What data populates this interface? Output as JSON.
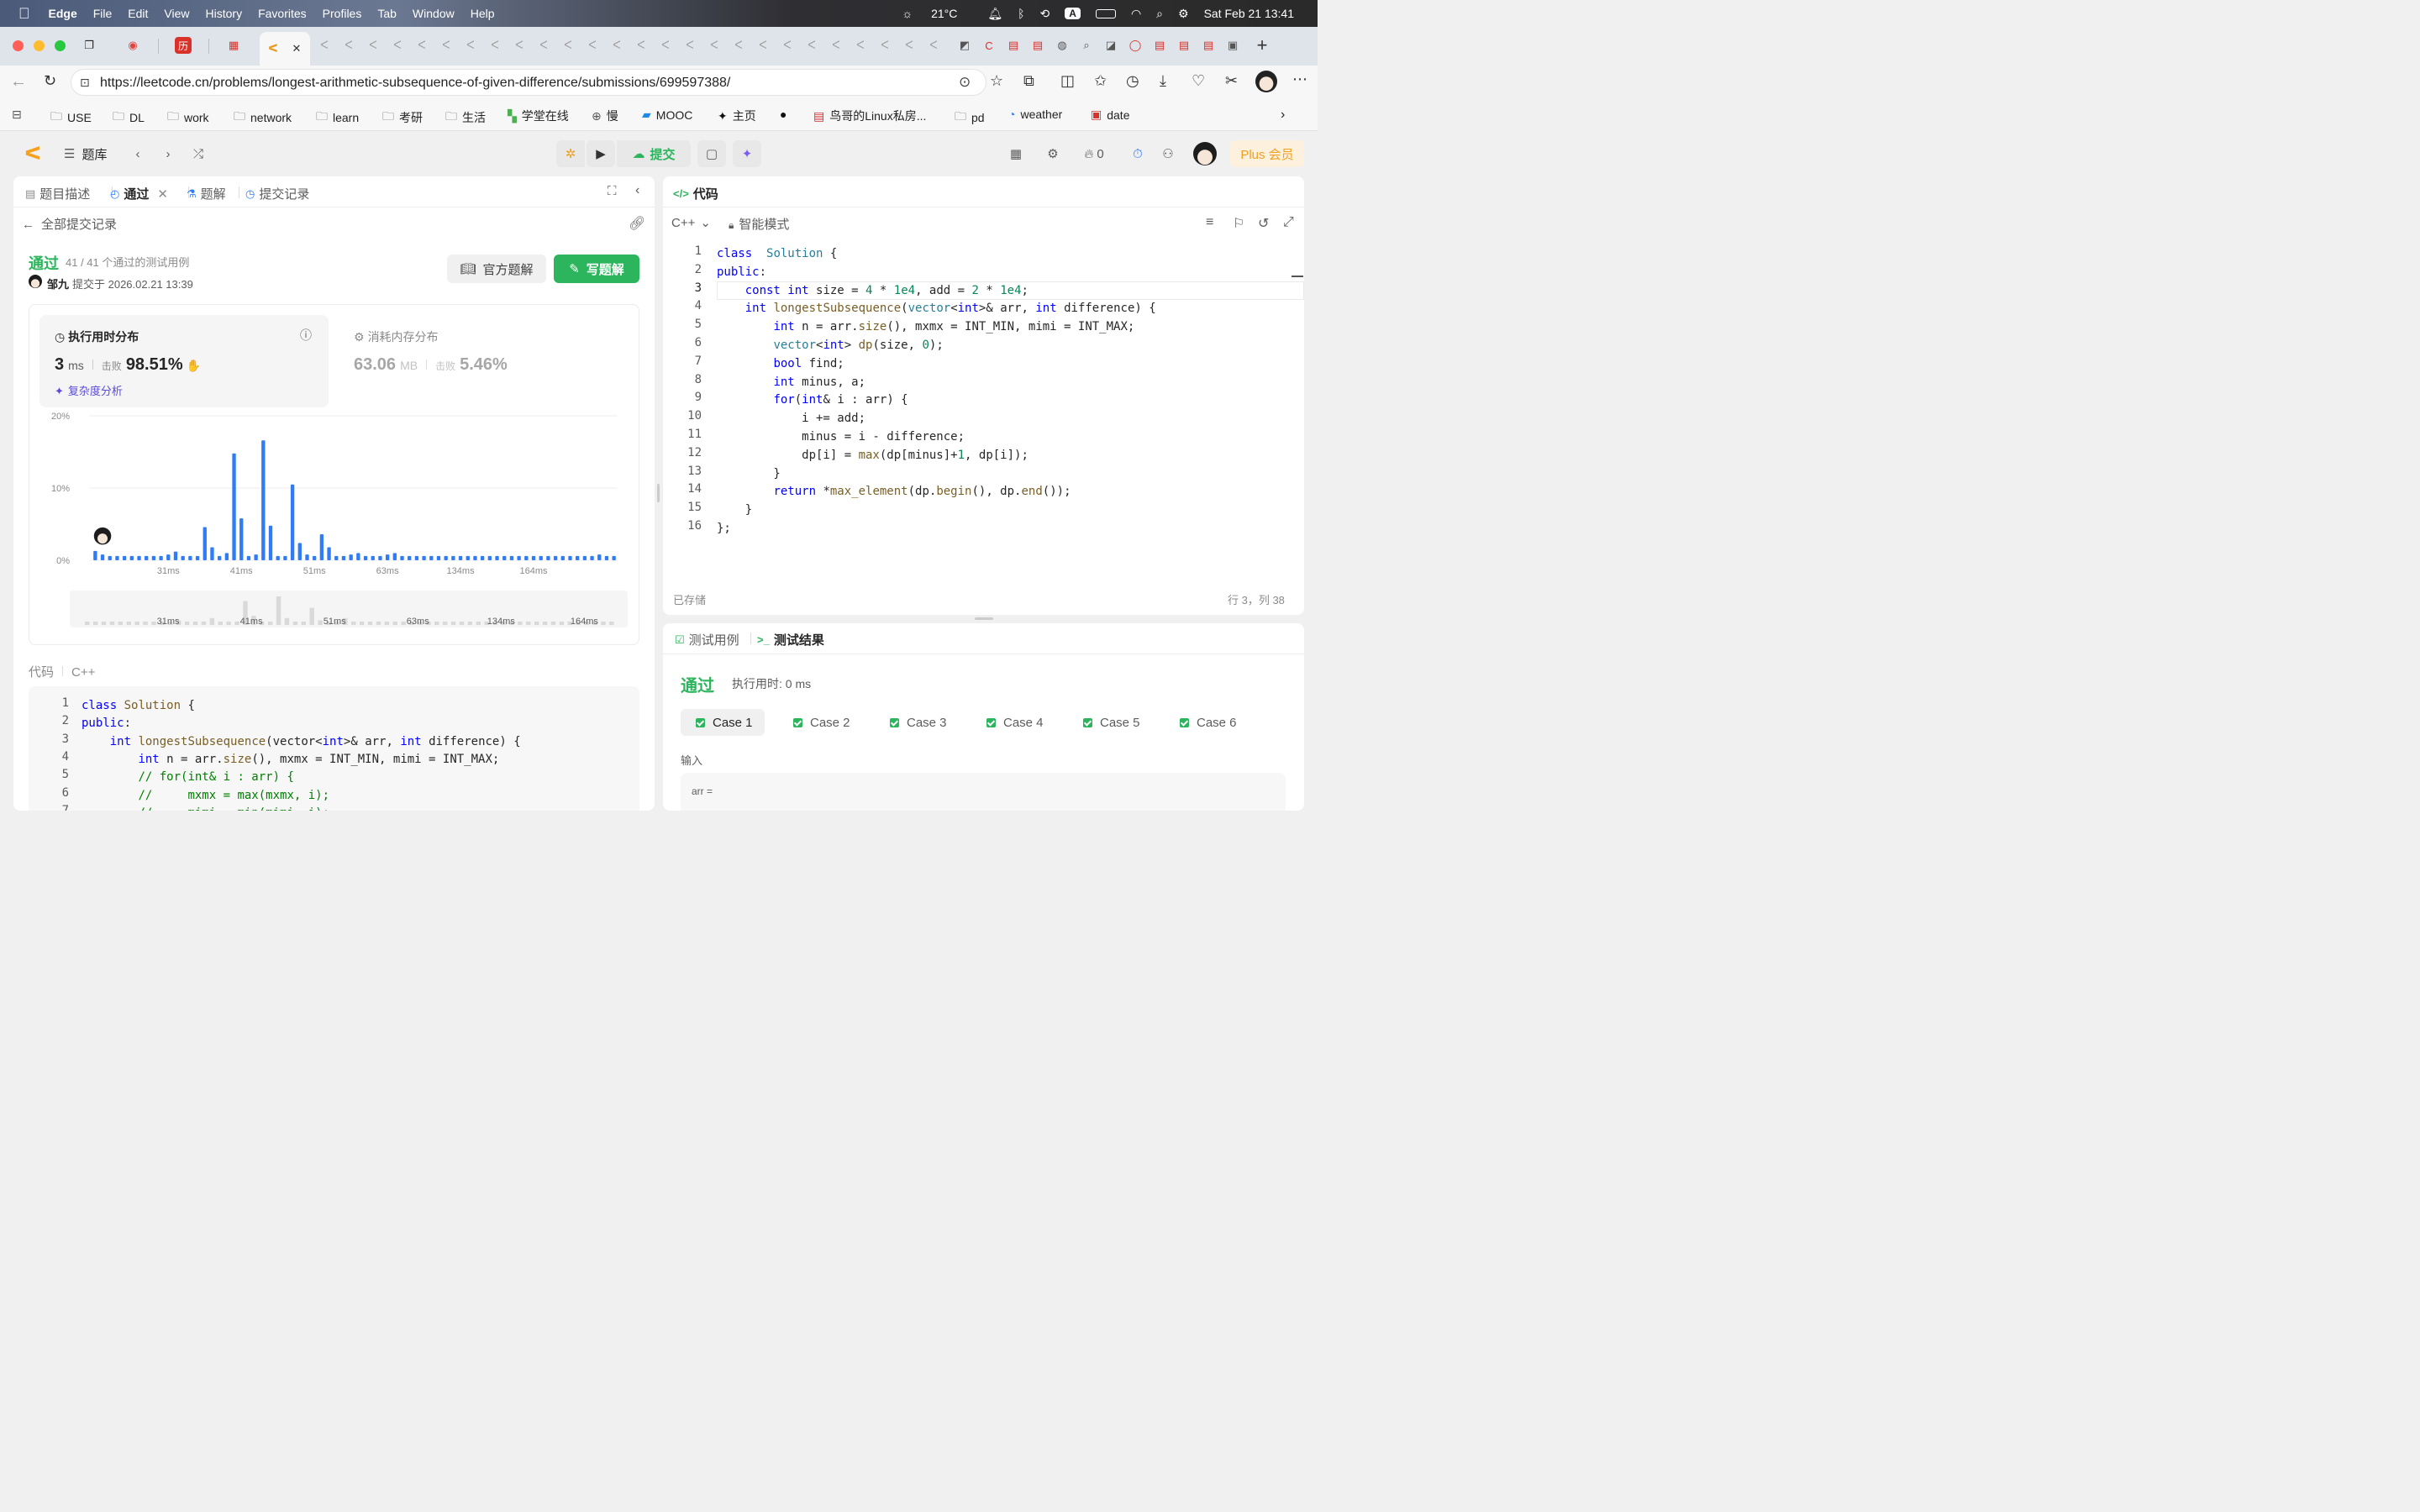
{
  "menubar": {
    "app": "Edge",
    "items": [
      "File",
      "Edit",
      "View",
      "History",
      "Favorites",
      "Profiles",
      "Tab",
      "Window",
      "Help"
    ],
    "weather": "21°C",
    "datetime": "Sat Feb 21  13:41",
    "input_source": "A"
  },
  "browser": {
    "url": "https://leetcode.cn/problems/longest-arithmetic-subsequence-of-given-difference/submissions/699597388/"
  },
  "bookmarks": [
    {
      "label": "",
      "icon": "reading-list"
    },
    {
      "label": "USE",
      "icon": "folder"
    },
    {
      "label": "DL",
      "icon": "folder"
    },
    {
      "label": "work",
      "icon": "folder"
    },
    {
      "label": "network",
      "icon": "folder"
    },
    {
      "label": "learn",
      "icon": "folder"
    },
    {
      "label": "考研",
      "icon": "folder"
    },
    {
      "label": "生活",
      "icon": "folder"
    },
    {
      "label": "学堂在线",
      "icon": "xuetang"
    },
    {
      "label": "慢",
      "icon": "globe"
    },
    {
      "label": "MOOC",
      "icon": "mooc"
    },
    {
      "label": "主页",
      "icon": "home-site"
    },
    {
      "label": "",
      "icon": "github"
    },
    {
      "label": "鸟哥的Linux私房...",
      "icon": "pdf"
    },
    {
      "label": "pd",
      "icon": "folder"
    },
    {
      "label": "weather",
      "icon": "weather"
    },
    {
      "label": "date",
      "icon": "calendar"
    }
  ],
  "lc": {
    "problem_bank": "题库",
    "submit": "提交",
    "fire_count": "0",
    "plus": "Plus 会员"
  },
  "left": {
    "tabs": [
      "题目描述",
      "通过",
      "题解",
      "提交记录"
    ],
    "back_label": "全部提交记录",
    "status": "通过",
    "tests": "41 / 41 个通过的测试用例",
    "user": "邹九",
    "submitted_at": "提交于 2026.02.21 13:39",
    "official_btn": "官方题解",
    "write_btn": "写题解",
    "runtime": {
      "title": "执行用时分布",
      "value": "3",
      "unit": "ms",
      "beat_label": "击败",
      "beat": "98.51%",
      "analysis": "复杂度分析"
    },
    "memory": {
      "title": "消耗内存分布",
      "value": "63.06",
      "unit": "MB",
      "beat_label": "击败",
      "beat": "5.46%"
    },
    "code_label": "代码",
    "code_lang": "C++"
  },
  "chart_data": {
    "type": "bar",
    "yticks": [
      "20%",
      "10%",
      "0%"
    ],
    "ylim": [
      0,
      20
    ],
    "xticks": [
      "31ms",
      "41ms",
      "51ms",
      "63ms",
      "134ms",
      "164ms"
    ],
    "values": [
      1.3,
      0.8,
      0.6,
      0.6,
      0.6,
      0.6,
      0.6,
      0.6,
      0.6,
      0.6,
      0.8,
      1.2,
      0.6,
      0.6,
      0.6,
      4.6,
      1.8,
      0.6,
      1,
      14.8,
      5.8,
      0.6,
      0.8,
      16.6,
      4.8,
      0.6,
      0.6,
      10.5,
      2.4,
      0.8,
      0.6,
      3.6,
      1.8,
      0.6,
      0.6,
      0.8,
      1,
      0.6,
      0.6,
      0.6,
      0.8,
      1,
      0.6,
      0.6,
      0.6,
      0.6,
      0.6,
      0.6,
      0.6,
      0.6,
      0.6,
      0.6,
      0.6,
      0.6,
      0.6,
      0.6,
      0.6,
      0.6,
      0.6,
      0.6,
      0.6,
      0.6,
      0.6,
      0.6,
      0.6,
      0.6,
      0.6,
      0.6,
      0.6,
      0.8,
      0.6,
      0.6
    ],
    "highlight_index": 1,
    "mini_values": [
      0.6,
      0.6,
      0.6,
      0.6,
      0.6,
      0.6,
      0.6,
      0.6,
      0.6,
      0.6,
      0.6,
      0.8,
      0.6,
      0.6,
      0.6,
      1.2,
      0.6,
      0.6,
      0.6,
      4.2,
      1.6,
      0.6,
      0.6,
      5,
      1.2,
      0.6,
      0.6,
      3,
      0.8,
      0.6,
      0.6,
      1.2,
      0.6,
      0.6,
      0.6,
      0.6,
      0.6,
      0.6,
      0.6,
      0.6,
      0.6,
      0.6,
      0.6,
      0.6,
      0.6,
      0.6,
      0.6,
      0.6,
      0.6,
      0.6,
      0.6,
      0.6,
      0.6,
      0.6,
      0.6,
      0.6,
      0.6,
      0.6,
      0.6,
      0.6,
      0.6,
      0.6,
      0.6,
      0.6
    ]
  },
  "editor": {
    "title": "代码",
    "lang": "C++",
    "mode": "智能模式",
    "saved": "已存储",
    "cursor": "行 3，列 38",
    "lines": [
      [
        [
          "kw",
          "class"
        ],
        [
          "",
          "  "
        ],
        [
          "cl",
          "Solution"
        ],
        [
          "",
          " {"
        ]
      ],
      [
        [
          "kw",
          "public"
        ],
        [
          "",
          ":"
        ]
      ],
      [
        [
          "",
          "    "
        ],
        [
          "kw",
          "const"
        ],
        [
          "",
          ""
        ],
        [
          "kw",
          " int"
        ],
        [
          "",
          " size = "
        ],
        [
          "num",
          "4"
        ],
        [
          "",
          " * "
        ],
        [
          "num",
          "1e4"
        ],
        [
          "",
          ", add = "
        ],
        [
          "num",
          "2"
        ],
        [
          "",
          " * "
        ],
        [
          "num",
          "1e4"
        ],
        [
          "",
          ";"
        ]
      ],
      [
        [
          "",
          "    "
        ],
        [
          "kw",
          "int"
        ],
        [
          "",
          ""
        ],
        [
          "fn",
          " longestSubsequence"
        ],
        [
          "",
          "("
        ],
        [
          "cl",
          "vector"
        ],
        [
          "",
          "<"
        ],
        [
          "kw",
          "int"
        ],
        [
          "",
          ">& arr, "
        ],
        [
          "kw",
          "int"
        ],
        [
          "",
          " difference) {"
        ]
      ],
      [
        [
          "",
          "        "
        ],
        [
          "kw",
          "int"
        ],
        [
          "",
          " n = arr."
        ],
        [
          "fn",
          "size"
        ],
        [
          "",
          "(), mxmx = INT_MIN, mimi = INT_MAX;"
        ]
      ],
      [
        [
          "",
          "        "
        ],
        [
          "cl",
          "vector"
        ],
        [
          "",
          "<"
        ],
        [
          "kw",
          "int"
        ],
        [
          "",
          "> "
        ],
        [
          "fn",
          "dp"
        ],
        [
          "",
          "(size, "
        ],
        [
          "num",
          "0"
        ],
        [
          "",
          ");"
        ]
      ],
      [
        [
          "",
          "        "
        ],
        [
          "kw",
          "bool"
        ],
        [
          "",
          " find;"
        ]
      ],
      [
        [
          "",
          "        "
        ],
        [
          "kw",
          "int"
        ],
        [
          "",
          " minus, a;"
        ]
      ],
      [
        [
          "",
          "        "
        ],
        [
          "kw",
          "for"
        ],
        [
          "",
          "("
        ],
        [
          "kw",
          "int"
        ],
        [
          "",
          "& i : arr) {"
        ]
      ],
      [
        [
          "",
          "            i += add;"
        ]
      ],
      [
        [
          "",
          "            minus = i - difference;"
        ]
      ],
      [
        [
          "",
          "            dp[i] = "
        ],
        [
          "fn",
          "max"
        ],
        [
          "",
          "(dp[minus]+"
        ],
        [
          "num",
          "1"
        ],
        [
          "",
          ", dp[i]);"
        ]
      ],
      [
        [
          "",
          "        }"
        ]
      ],
      [
        [
          "",
          "        "
        ],
        [
          "kw",
          "return"
        ],
        [
          "",
          " *"
        ],
        [
          "fn",
          "max_element"
        ],
        [
          "",
          "(dp."
        ],
        [
          "fn",
          "begin"
        ],
        [
          "",
          "(), dp."
        ],
        [
          "fn",
          "end"
        ],
        [
          "",
          "());"
        ]
      ],
      [
        [
          "",
          "    }"
        ]
      ],
      [
        [
          "",
          "};"
        ]
      ]
    ]
  },
  "leftcode": {
    "lines": [
      [
        [
          "kw",
          "class"
        ],
        [
          "",
          " "
        ],
        [
          "fn",
          "Solution"
        ],
        [
          "",
          " {"
        ]
      ],
      [
        [
          "kw",
          "public"
        ],
        [
          "",
          ":"
        ]
      ],
      [
        [
          "",
          "    "
        ],
        [
          "kw",
          "int"
        ],
        [
          "",
          " "
        ],
        [
          "fn",
          "longestSubsequence"
        ],
        [
          "",
          "(vector<"
        ],
        [
          "kw",
          "int"
        ],
        [
          "",
          ">& arr, "
        ],
        [
          "kw",
          "int"
        ],
        [
          "",
          " difference) {"
        ]
      ],
      [
        [
          "",
          "        "
        ],
        [
          "kw",
          "int"
        ],
        [
          "",
          " n = arr."
        ],
        [
          "fn",
          "size"
        ],
        [
          "",
          "(), mxmx = INT_MIN, mimi = INT_MAX;"
        ]
      ],
      [
        [
          "",
          "        "
        ],
        [
          "ct",
          "// for(int& i : arr) {"
        ]
      ],
      [
        [
          "",
          "        "
        ],
        [
          "ct",
          "//     mxmx = max(mxmx, i);"
        ]
      ],
      [
        [
          "",
          "        "
        ],
        [
          "ct",
          "//     mimi = min(mimi, i);"
        ]
      ]
    ]
  },
  "results": {
    "tabs": [
      "测试用例",
      "测试结果"
    ],
    "status": "通过",
    "runtime": "执行用时: 0 ms",
    "cases": [
      "Case 1",
      "Case 2",
      "Case 3",
      "Case 4",
      "Case 5",
      "Case 6"
    ],
    "input_label": "输入",
    "var": "arr ="
  }
}
